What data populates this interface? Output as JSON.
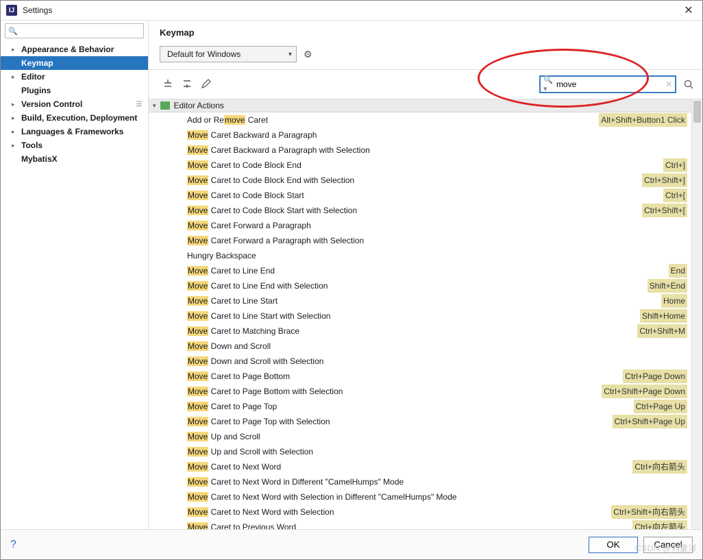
{
  "window": {
    "title": "Settings"
  },
  "sidebar": {
    "search_placeholder": "",
    "items": [
      {
        "label": "Appearance & Behavior",
        "expandable": true,
        "bold": true,
        "selected": false
      },
      {
        "label": "Keymap",
        "expandable": false,
        "bold": true,
        "selected": true
      },
      {
        "label": "Editor",
        "expandable": true,
        "bold": true,
        "selected": false
      },
      {
        "label": "Plugins",
        "expandable": false,
        "bold": true,
        "selected": false
      },
      {
        "label": "Version Control",
        "expandable": true,
        "bold": true,
        "selected": false,
        "badge": true
      },
      {
        "label": "Build, Execution, Deployment",
        "expandable": true,
        "bold": true,
        "selected": false
      },
      {
        "label": "Languages & Frameworks",
        "expandable": true,
        "bold": true,
        "selected": false
      },
      {
        "label": "Tools",
        "expandable": true,
        "bold": true,
        "selected": false
      },
      {
        "label": "MybatisX",
        "expandable": false,
        "bold": true,
        "selected": false
      }
    ]
  },
  "panel": {
    "title": "Keymap",
    "scheme": "Default for Windows",
    "search_value": "move"
  },
  "group": {
    "label": "Editor Actions"
  },
  "actions": [
    {
      "pre": "Add or Re",
      "hl": "move",
      "post": " Caret",
      "shortcut": "Alt+Shift+Button1 Click"
    },
    {
      "pre": "",
      "hl": "Move",
      "post": " Caret Backward a Paragraph",
      "shortcut": ""
    },
    {
      "pre": "",
      "hl": "Move",
      "post": " Caret Backward a Paragraph with Selection",
      "shortcut": ""
    },
    {
      "pre": "",
      "hl": "Move",
      "post": " Caret to Code Block End",
      "shortcut": "Ctrl+]"
    },
    {
      "pre": "",
      "hl": "Move",
      "post": " Caret to Code Block End with Selection",
      "shortcut": "Ctrl+Shift+]"
    },
    {
      "pre": "",
      "hl": "Move",
      "post": " Caret to Code Block Start",
      "shortcut": "Ctrl+["
    },
    {
      "pre": "",
      "hl": "Move",
      "post": " Caret to Code Block Start with Selection",
      "shortcut": "Ctrl+Shift+["
    },
    {
      "pre": "",
      "hl": "Move",
      "post": " Caret Forward a Paragraph",
      "shortcut": ""
    },
    {
      "pre": "",
      "hl": "Move",
      "post": " Caret Forward a Paragraph with Selection",
      "shortcut": ""
    },
    {
      "pre": "Hungry Backspace",
      "hl": "",
      "post": "",
      "shortcut": ""
    },
    {
      "pre": "",
      "hl": "Move",
      "post": " Caret to Line End",
      "shortcut": "End"
    },
    {
      "pre": "",
      "hl": "Move",
      "post": " Caret to Line End with Selection",
      "shortcut": "Shift+End"
    },
    {
      "pre": "",
      "hl": "Move",
      "post": " Caret to Line Start",
      "shortcut": "Home"
    },
    {
      "pre": "",
      "hl": "Move",
      "post": " Caret to Line Start with Selection",
      "shortcut": "Shift+Home"
    },
    {
      "pre": "",
      "hl": "Move",
      "post": " Caret to Matching Brace",
      "shortcut": "Ctrl+Shift+M"
    },
    {
      "pre": "",
      "hl": "Move",
      "post": " Down and Scroll",
      "shortcut": ""
    },
    {
      "pre": "",
      "hl": "Move",
      "post": " Down and Scroll with Selection",
      "shortcut": ""
    },
    {
      "pre": "",
      "hl": "Move",
      "post": " Caret to Page Bottom",
      "shortcut": "Ctrl+Page Down"
    },
    {
      "pre": "",
      "hl": "Move",
      "post": " Caret to Page Bottom with Selection",
      "shortcut": "Ctrl+Shift+Page Down"
    },
    {
      "pre": "",
      "hl": "Move",
      "post": " Caret to Page Top",
      "shortcut": "Ctrl+Page Up"
    },
    {
      "pre": "",
      "hl": "Move",
      "post": " Caret to Page Top with Selection",
      "shortcut": "Ctrl+Shift+Page Up"
    },
    {
      "pre": "",
      "hl": "Move",
      "post": " Up and Scroll",
      "shortcut": ""
    },
    {
      "pre": "",
      "hl": "Move",
      "post": " Up and Scroll with Selection",
      "shortcut": ""
    },
    {
      "pre": "",
      "hl": "Move",
      "post": " Caret to Next Word",
      "shortcut": "Ctrl+向右箭头"
    },
    {
      "pre": "",
      "hl": "Move",
      "post": " Caret to Next Word in Different \"CamelHumps\" Mode",
      "shortcut": ""
    },
    {
      "pre": "",
      "hl": "Move",
      "post": " Caret to Next Word with Selection in Different \"CamelHumps\" Mode",
      "shortcut": ""
    },
    {
      "pre": "",
      "hl": "Move",
      "post": " Caret to Next Word with Selection",
      "shortcut": "Ctrl+Shift+向右箭头"
    },
    {
      "pre": "",
      "hl": "Move",
      "post": " Caret to Previous Word",
      "shortcut": "Ctrl+向左箭头"
    }
  ],
  "buttons": {
    "ok": "OK",
    "cancel": "Cancel"
  },
  "watermark": "CSDN @刘重洋"
}
